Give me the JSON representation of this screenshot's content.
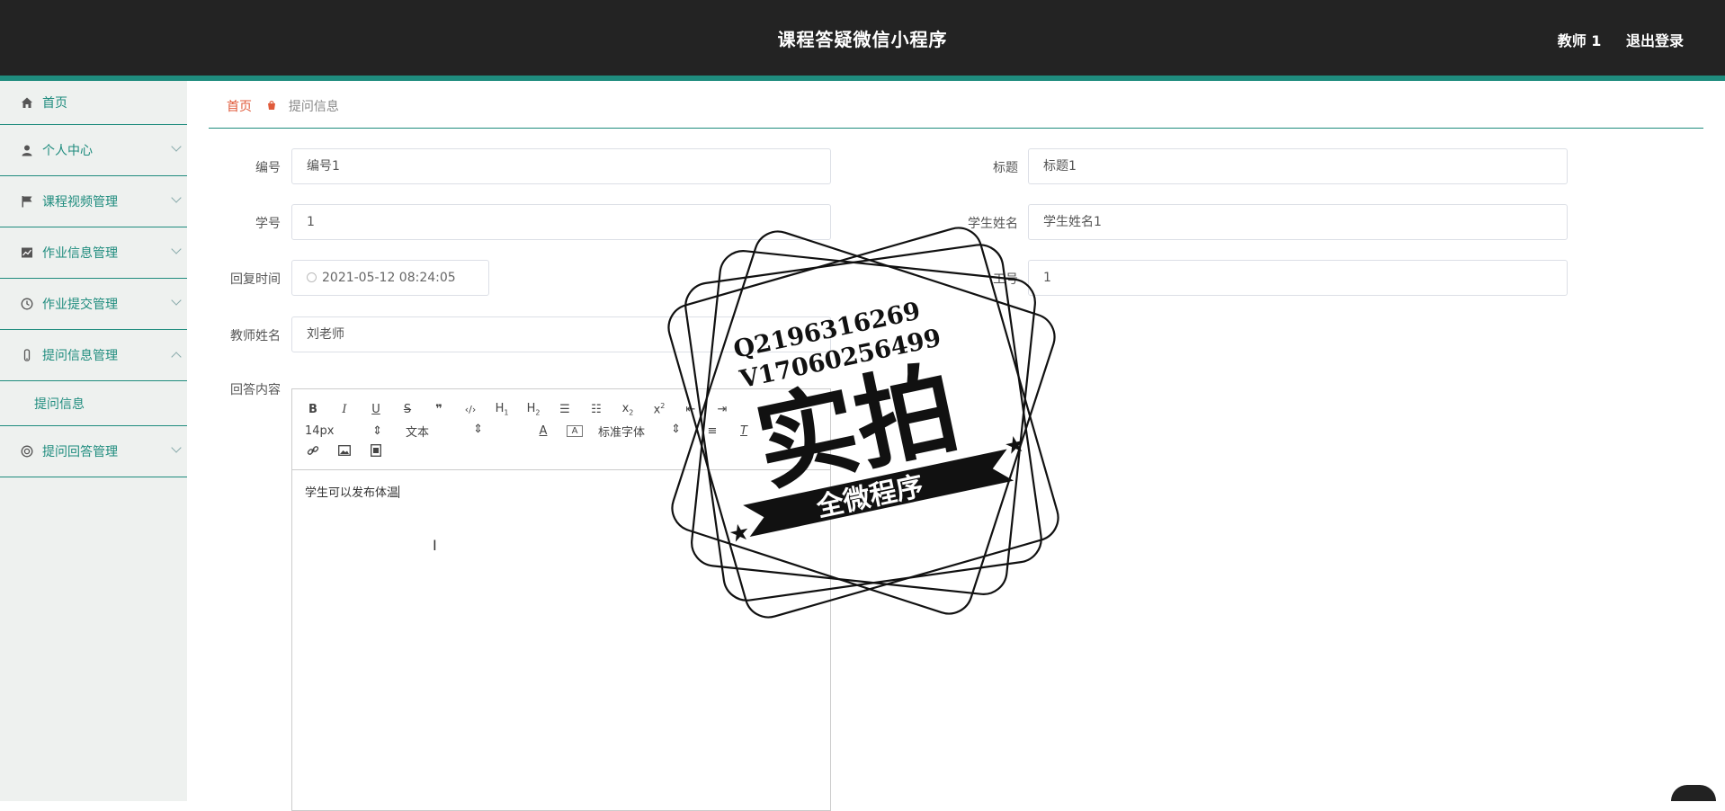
{
  "header": {
    "title": "课程答疑微信小程序",
    "user": "教师 1",
    "logout": "退出登录"
  },
  "sidebar": {
    "items": [
      {
        "label": "首页",
        "icon": "home-icon"
      },
      {
        "label": "个人中心",
        "icon": "user-icon"
      },
      {
        "label": "课程视频管理",
        "icon": "flag-icon"
      },
      {
        "label": "作业信息管理",
        "icon": "chart-icon"
      },
      {
        "label": "作业提交管理",
        "icon": "clock-icon"
      },
      {
        "label": "提问信息管理",
        "icon": "mic-icon"
      },
      {
        "label": "提问信息",
        "icon": ""
      },
      {
        "label": "提问回答管理",
        "icon": "support-icon"
      }
    ]
  },
  "breadcrumb": {
    "home": "首页",
    "current": "提问信息"
  },
  "form": {
    "number_label": "编号",
    "number_value": "编号1",
    "title_label": "标题",
    "title_value": "标题1",
    "student_id_label": "学号",
    "student_id_value": "1",
    "student_name_label": "学生姓名",
    "student_name_value": "学生姓名1",
    "reply_time_label": "回复时间",
    "reply_time_value": "2021-05-12 08:24:05",
    "job_no_label": "工号",
    "job_no_value": "1",
    "teacher_name_label": "教师姓名",
    "teacher_name_value": "刘老师",
    "answer_label": "回答内容"
  },
  "editor": {
    "font_size": "14px",
    "block_type": "文本",
    "font_family": "标准字体",
    "content": "学生可以发布体温"
  },
  "watermark": {
    "line1": "Q2196316269",
    "line2": "V17060256499",
    "big": "实拍",
    "banner": "全微程序"
  }
}
